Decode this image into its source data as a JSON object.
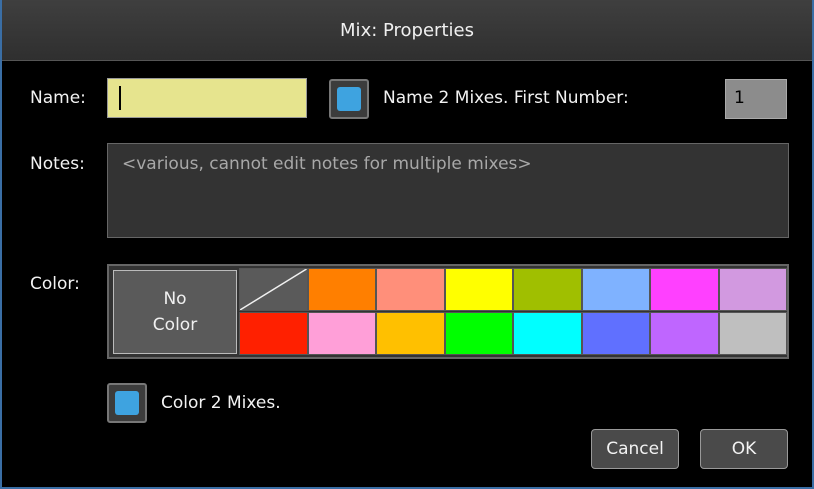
{
  "dialog": {
    "title": "Mix: Properties"
  },
  "name": {
    "label": "Name:",
    "value": ""
  },
  "name_multiple": {
    "checked": true,
    "label": "Name 2 Mixes. First Number:",
    "first_number": "1"
  },
  "notes": {
    "label": "Notes:",
    "placeholder": "<various, cannot edit notes for multiple mixes>"
  },
  "color": {
    "label": "Color:",
    "no_color_line1": "No",
    "no_color_line2": "Color",
    "swatches_top": [
      "#5a5a5a",
      "#ff7f00",
      "#ff8f7a",
      "#ffff00",
      "#a0bf00",
      "#7fb2ff",
      "#ff40ff",
      "#d299e0"
    ],
    "swatches_bottom": [
      "#ff2000",
      "#ff9fd8",
      "#ffc000",
      "#00ff00",
      "#00ffff",
      "#6070ff",
      "#bf66ff",
      "#bfbfbf"
    ]
  },
  "color_multiple": {
    "checked": true,
    "label": "Color 2 Mixes."
  },
  "buttons": {
    "cancel": "Cancel",
    "ok": "OK"
  },
  "accent": "#3ea3e0"
}
